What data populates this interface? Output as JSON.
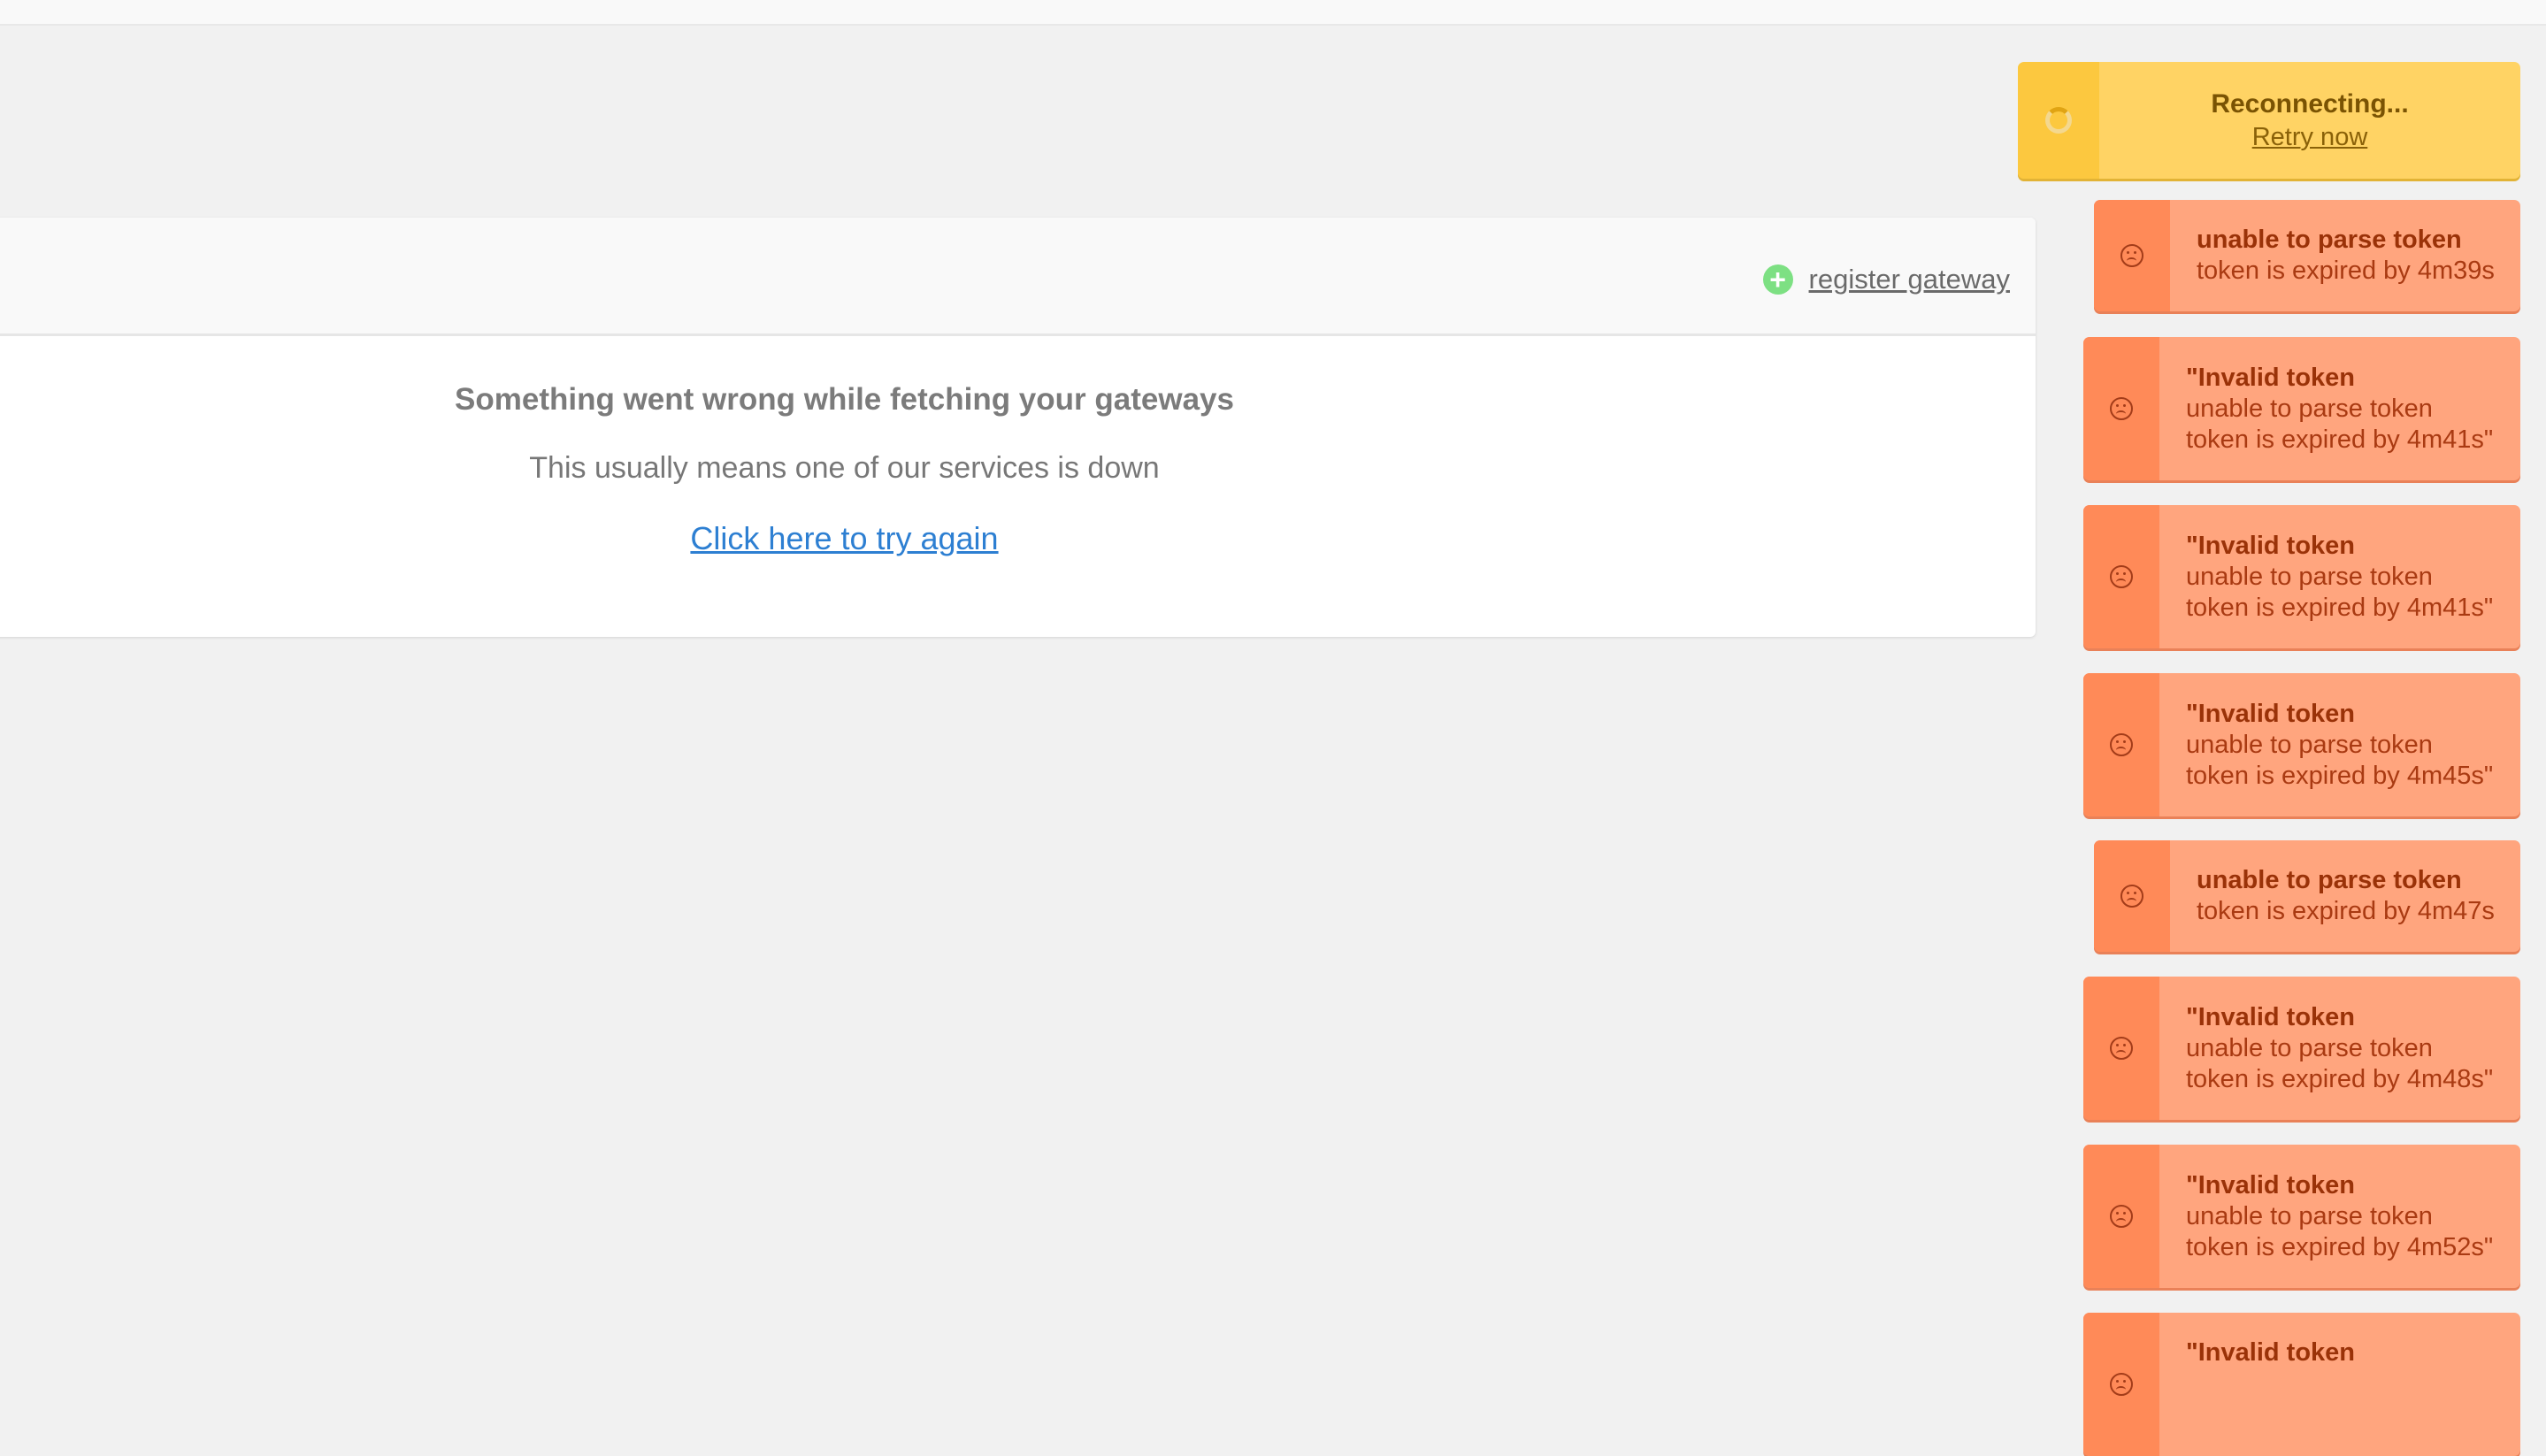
{
  "reconnect": {
    "title": "Reconnecting...",
    "retry_label": "Retry now"
  },
  "panel": {
    "register_label": "register gateway",
    "error_title": "Something went wrong while fetching your gateways",
    "error_subtitle": "This usually means one of our services is down",
    "retry_label": "Click here to try again"
  },
  "toasts": [
    {
      "title": "unable to parse token",
      "lines": [
        "token is expired by 4m39s"
      ]
    },
    {
      "title": "\"Invalid token",
      "lines": [
        "unable to parse token",
        "token is expired by 4m41s\""
      ]
    },
    {
      "title": "\"Invalid token",
      "lines": [
        "unable to parse token",
        "token is expired by 4m41s\""
      ]
    },
    {
      "title": "\"Invalid token",
      "lines": [
        "unable to parse token",
        "token is expired by 4m45s\""
      ]
    },
    {
      "title": "unable to parse token",
      "lines": [
        "token is expired by 4m47s"
      ]
    },
    {
      "title": "\"Invalid token",
      "lines": [
        "unable to parse token",
        "token is expired by 4m48s\""
      ]
    },
    {
      "title": "\"Invalid token",
      "lines": [
        "unable to parse token",
        "token is expired by 4m52s\""
      ]
    },
    {
      "title": "\"Invalid token",
      "lines": []
    }
  ],
  "colors": {
    "background": "#f1f1f1",
    "reconnect_bg": "#ffd364",
    "reconnect_icon_bg": "#fcc83f",
    "toast_bg": "#ffa57e",
    "toast_icon_bg": "#ff8a58",
    "toast_text": "#a93a12",
    "link_blue": "#2d7fd2",
    "plus_green": "#7de083"
  },
  "icons": {
    "reconnect": "spinner-icon",
    "toast": "sad-face-icon",
    "register": "plus-circle-icon"
  }
}
